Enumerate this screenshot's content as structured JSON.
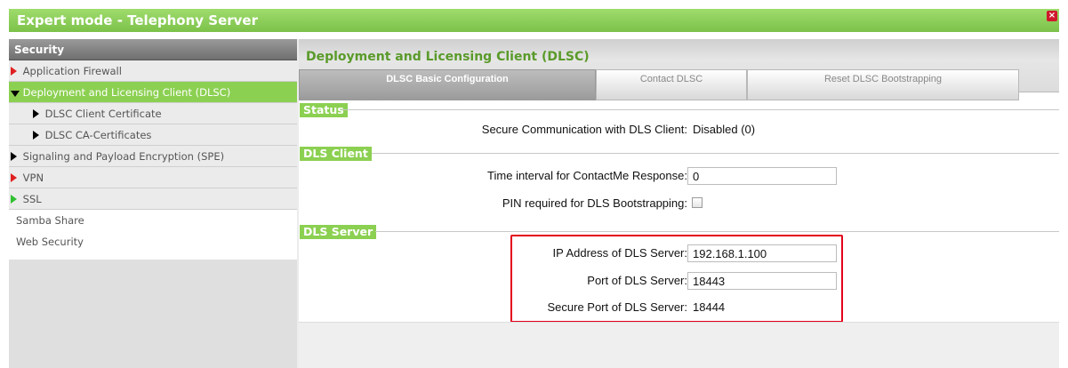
{
  "window": {
    "title": "Expert mode - Telephony Server",
    "close_glyph": "×"
  },
  "sidebar": {
    "header": "Security",
    "items": [
      {
        "label": "Application Firewall"
      },
      {
        "label": "Deployment and Licensing Client (DLSC)"
      },
      {
        "label": "DLSC Client Certificate"
      },
      {
        "label": "DLSC CA-Certificates"
      },
      {
        "label": "Signaling and Payload Encryption (SPE)"
      },
      {
        "label": "VPN"
      },
      {
        "label": "SSL"
      },
      {
        "label": "Samba Share"
      },
      {
        "label": "Web Security"
      }
    ]
  },
  "main": {
    "title": "Deployment and Licensing Client (DLSC)",
    "tabs": [
      {
        "label": "DLSC Basic Configuration"
      },
      {
        "label": "Contact DLSC"
      },
      {
        "label": "Reset DLSC Bootstrapping"
      }
    ],
    "status": {
      "section": "Status",
      "secure_comm_label": "Secure Communication with DLS Client:",
      "secure_comm_value": "Disabled (0)"
    },
    "dls_client": {
      "section": "DLS Client",
      "contactme_label": "Time interval for ContactMe Response:",
      "contactme_value": "0",
      "pin_label": "PIN required for DLS Bootstrapping:"
    },
    "dls_server": {
      "section": "DLS Server",
      "ip_label": "IP Address of DLS Server:",
      "ip_value": "192.168.1.100",
      "port_label": "Port of DLS Server:",
      "port_value": "18443",
      "secure_port_label": "Secure Port of DLS Server:",
      "secure_port_value": "18444"
    }
  },
  "colors": {
    "accent_green": "#8cd052",
    "title_green": "#5a9a2a",
    "highlight_red": "#e3001b"
  }
}
